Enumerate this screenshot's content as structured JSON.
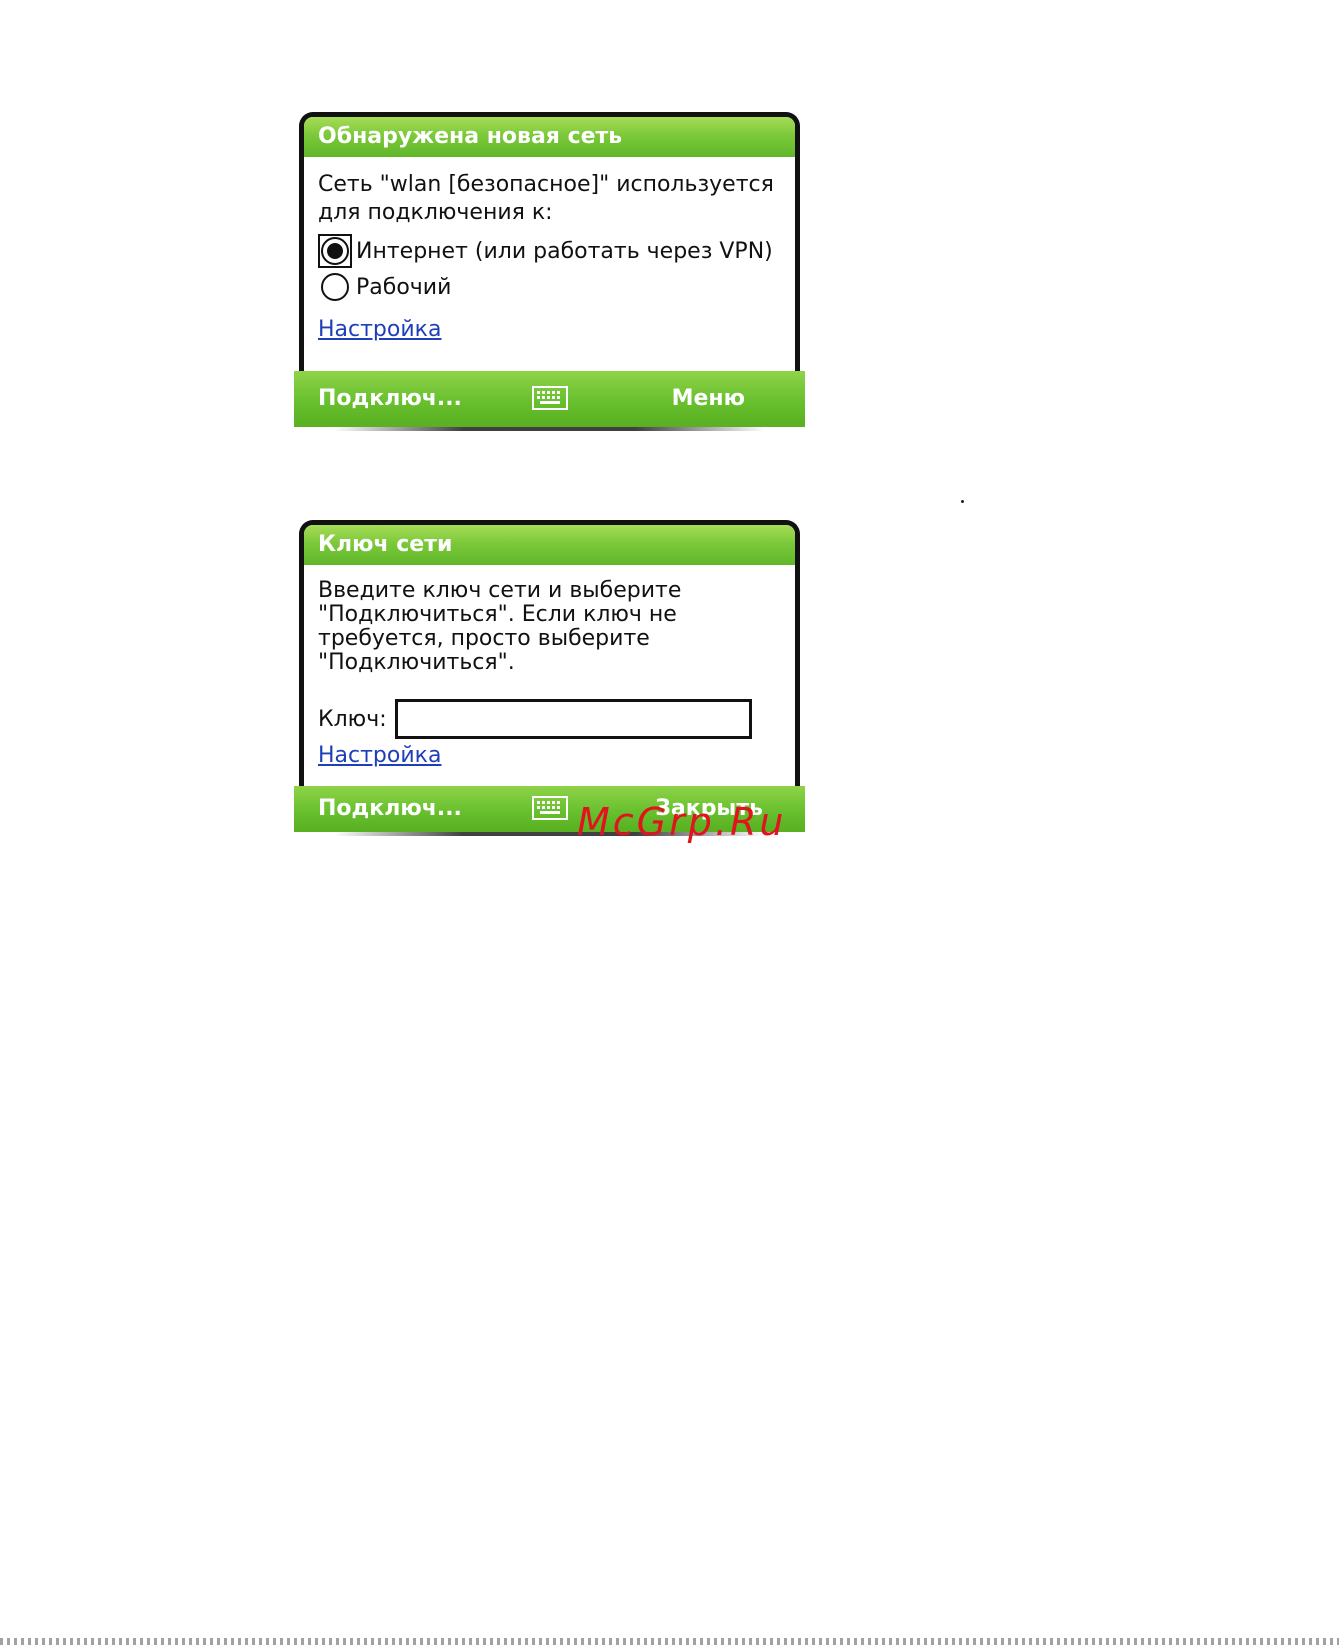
{
  "dialog1": {
    "title": "Обнаружена новая сеть",
    "message_line1": "Сеть \"wlan [безопасное]\" используется",
    "message_line2": "для подключения к:",
    "options": [
      {
        "label": "Интернет (или работать через VPN)",
        "selected": true
      },
      {
        "label": "Рабочий",
        "selected": false
      }
    ],
    "settings_link": "Настройка",
    "softkey_left": "Подключ...",
    "softkey_right": "Меню"
  },
  "dialog2": {
    "title": "Ключ сети",
    "instructions": [
      "Введите ключ сети и выберите",
      "\"Подключиться\". Если ключ не",
      "требуется, просто выберите",
      "\"Подключиться\"."
    ],
    "key_label": "Ключ:",
    "key_value": "",
    "settings_link": "Настройка",
    "softkey_left": "Подключ...",
    "softkey_right": "Закрыть"
  },
  "watermark": "McGrp.Ru",
  "colors": {
    "title_green": "#7cc93a",
    "softkey_green": "#68c02e",
    "link_blue": "#1f3fb8",
    "watermark_red": "#e0141e"
  }
}
